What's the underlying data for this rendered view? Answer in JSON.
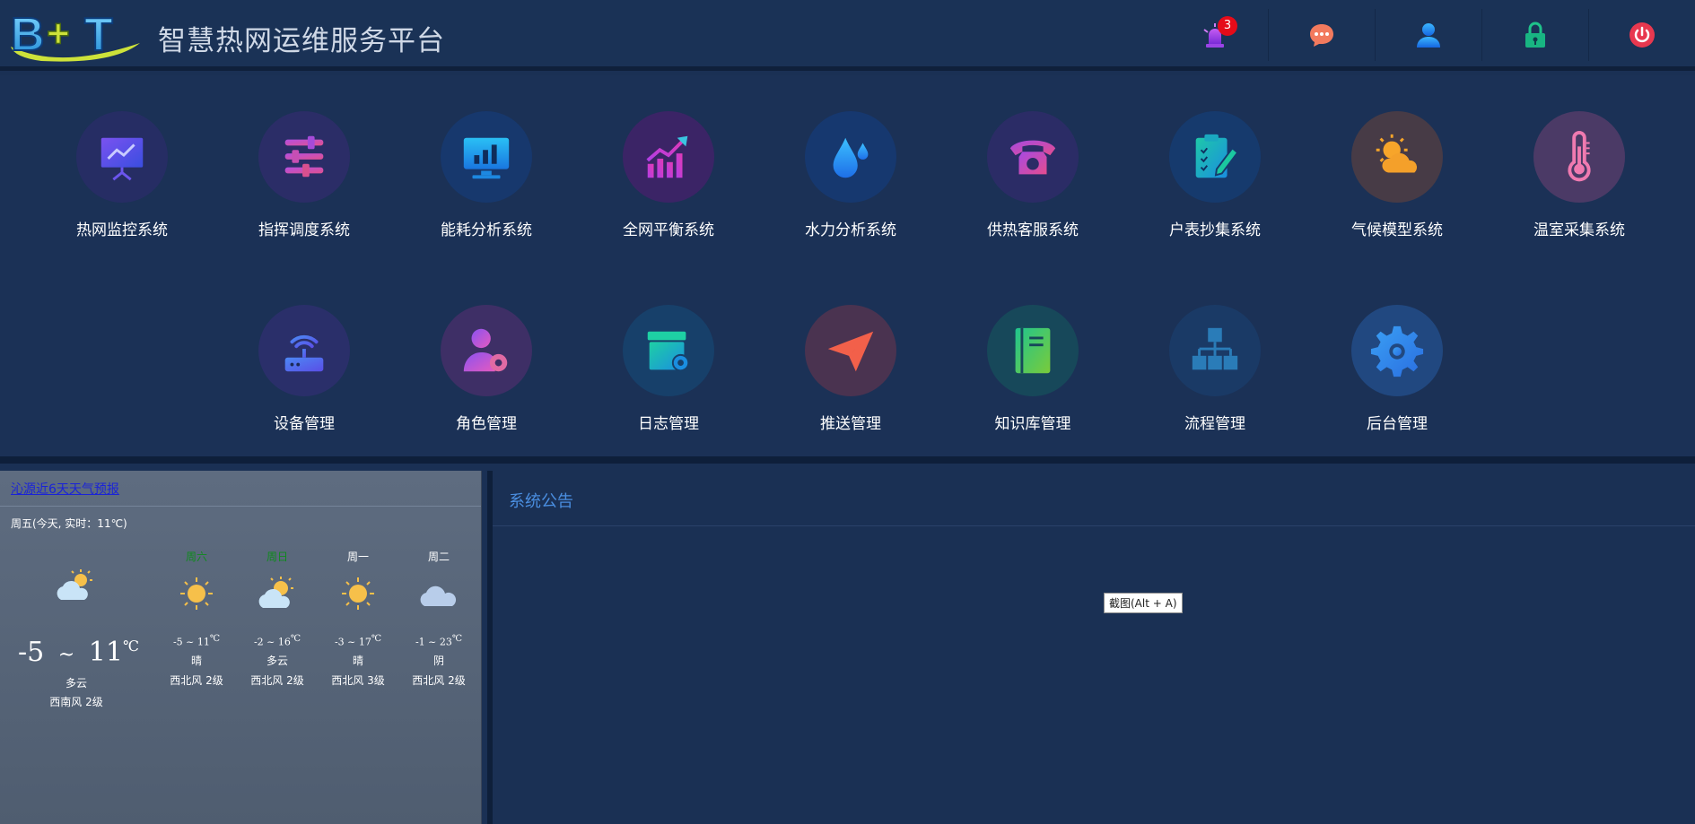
{
  "header": {
    "title": "智慧热网运维服务平台",
    "alarm_count": "3",
    "icons": [
      "alarm-icon",
      "message-icon",
      "user-icon",
      "lock-icon",
      "power-icon"
    ]
  },
  "modules": [
    {
      "label": "热网监控系统",
      "icon": "presentation-chart-icon"
    },
    {
      "label": "指挥调度系统",
      "icon": "sliders-icon"
    },
    {
      "label": "能耗分析系统",
      "icon": "monitor-bar-chart-icon"
    },
    {
      "label": "全网平衡系统",
      "icon": "trend-chart-icon"
    },
    {
      "label": "水力分析系统",
      "icon": "water-drop-icon"
    },
    {
      "label": "供热客服系统",
      "icon": "telephone-icon"
    },
    {
      "label": "户表抄集系统",
      "icon": "clipboard-edit-icon"
    },
    {
      "label": "气候模型系统",
      "icon": "sun-cloud-icon"
    },
    {
      "label": "温室采集系统",
      "icon": "thermometer-icon"
    },
    {
      "label": "设备管理",
      "icon": "router-icon"
    },
    {
      "label": "角色管理",
      "icon": "user-gear-icon"
    },
    {
      "label": "日志管理",
      "icon": "box-gear-icon"
    },
    {
      "label": "推送管理",
      "icon": "paper-plane-icon"
    },
    {
      "label": "知识库管理",
      "icon": "notebook-icon"
    },
    {
      "label": "流程管理",
      "icon": "flowchart-icon"
    },
    {
      "label": "后台管理",
      "icon": "settings-gear-icon"
    }
  ],
  "weather": {
    "link": "沁源近6天天气预报",
    "today_line": "周五(今天, 实时：11℃)",
    "today": {
      "low": "-5",
      "tilde": "~",
      "high": "11",
      "unit": "℃",
      "desc": "多云",
      "wind": "西南风 2级"
    },
    "days": [
      {
        "name": "周六",
        "weekend": true,
        "low": "-5",
        "high": "11",
        "unit": "℃",
        "desc": "晴",
        "wind": "西北风 2级",
        "icon": "sun"
      },
      {
        "name": "周日",
        "weekend": true,
        "low": "-2",
        "high": "16",
        "unit": "℃",
        "desc": "多云",
        "wind": "西北风 2级",
        "icon": "suncloud"
      },
      {
        "name": "周一",
        "weekend": false,
        "low": "-3",
        "high": "17",
        "unit": "℃",
        "desc": "晴",
        "wind": "西北风 3级",
        "icon": "sun"
      },
      {
        "name": "周二",
        "weekend": false,
        "low": "-1",
        "high": "23",
        "unit": "℃",
        "desc": "阴",
        "wind": "西北风 2级",
        "icon": "cloud"
      }
    ]
  },
  "notice": {
    "title": "系统公告",
    "tooltip": "截图(Alt + A)"
  },
  "colors": {
    "bg": "#1a3054",
    "accent": "#4a8ee0",
    "badge": "#e50b19"
  }
}
